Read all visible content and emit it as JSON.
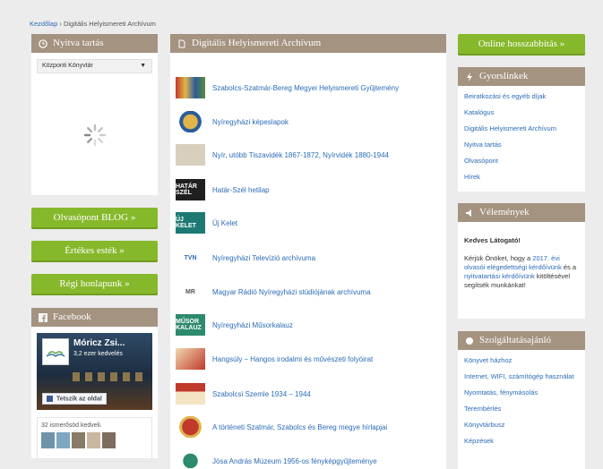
{
  "breadcrumb": {
    "home": "Kezdőlap",
    "separator": "›",
    "current": "Digitális Helyismereti Archívum"
  },
  "hours": {
    "title": "Nyitva tartás",
    "icon": "clock-icon",
    "select_value": "Központi Könyvtár"
  },
  "buttons": {
    "blog": "Olvasópont BLOG »",
    "evenings": "Értékes esték »",
    "old_site": "Régi honlapunk »",
    "renew": "Online hosszabbítás »"
  },
  "facebook": {
    "title": "Facebook",
    "page_name": "Móricz Zsi...",
    "likes": "3,2 ezer kedvelés",
    "like_button": "Tetszik az oldal",
    "friends_text": "32 ismerősöd kedveli."
  },
  "archive": {
    "title": "Digitális Helyismereti Archívum",
    "items": [
      {
        "label": "Szabolcs-Szatmár-Bereg Megyei Helyismereti Gyűjtemény",
        "thumb": "crest",
        "thumb_text": ""
      },
      {
        "label": "Nyíregyházi képeslapok",
        "thumb": "crest2",
        "thumb_text": ""
      },
      {
        "label": "Nyír, utóbb Tiszavidék 1867-1872, Nyírvidék 1880-1944",
        "thumb": "newspaper",
        "thumb_text": ""
      },
      {
        "label": "Határ-Szél hetilap",
        "thumb": "hatar",
        "thumb_text": "HATÁR SZÉL"
      },
      {
        "label": "Új Kelet",
        "thumb": "ujkelet",
        "thumb_text": "ÚJ KELET"
      },
      {
        "label": "Nyíregyházi Televízió archívuma",
        "thumb": "tv",
        "thumb_text": "TVN"
      },
      {
        "label": "Magyar Rádió Nyíregyházi stúdiójának archívuma",
        "thumb": "radio",
        "thumb_text": "MR"
      },
      {
        "label": "Nyíregyházi Műsorkalauz",
        "thumb": "musor",
        "thumb_text": "MŰSOR KALAUZ"
      },
      {
        "label": "Hangsúly – Hangos irodalmi és művészeti folyóirat",
        "thumb": "hangsuly",
        "thumb_text": ""
      },
      {
        "label": "Szabolcsi Szemle 1934 – 1944",
        "thumb": "szemle",
        "thumb_text": ""
      },
      {
        "label": "A történeti Szatmár, Szabolcs és Bereg megye hírlapjai",
        "thumb": "crest3",
        "thumb_text": ""
      },
      {
        "label": "Jósa András Múzeum 1956-os fényképgyűjteménye",
        "thumb": "muzeum",
        "thumb_text": ""
      }
    ]
  },
  "quick": {
    "title": "Gyorslinkek",
    "icon": "lightning-icon",
    "links": [
      "Beiratkozási és egyéb díjak",
      "Katalógus",
      "Digitális Helyismereti Archívum",
      "Nyitva tartás",
      "Olvasópont",
      "Hírek"
    ]
  },
  "opinions": {
    "title": "Vélemények",
    "icon": "megaphone-icon",
    "greeting": "Kedves Látogató!",
    "text_before": "Kérjük Önöket, hogy a ",
    "link1": "2017. évi olvasói elégedettségi kérdőívünk",
    "text_mid": " és a ",
    "link2": "nyitvatartási kérdőívünk",
    "text_after": " kitöltésével segítsék munkánkat!"
  },
  "services": {
    "title": "Szolgáltatásajánló",
    "icon": "circle-icon",
    "links": [
      "Könyvet házhoz",
      "Internet, WIFI, számítógép használat",
      "Nyomtatás, fénymásolás",
      "Terembérlés",
      "Könyvtárbusz",
      "Képzések"
    ]
  },
  "colors": {
    "panel_header": "#a49380",
    "button_green": "#86b82b",
    "link": "#2a6bb7"
  }
}
